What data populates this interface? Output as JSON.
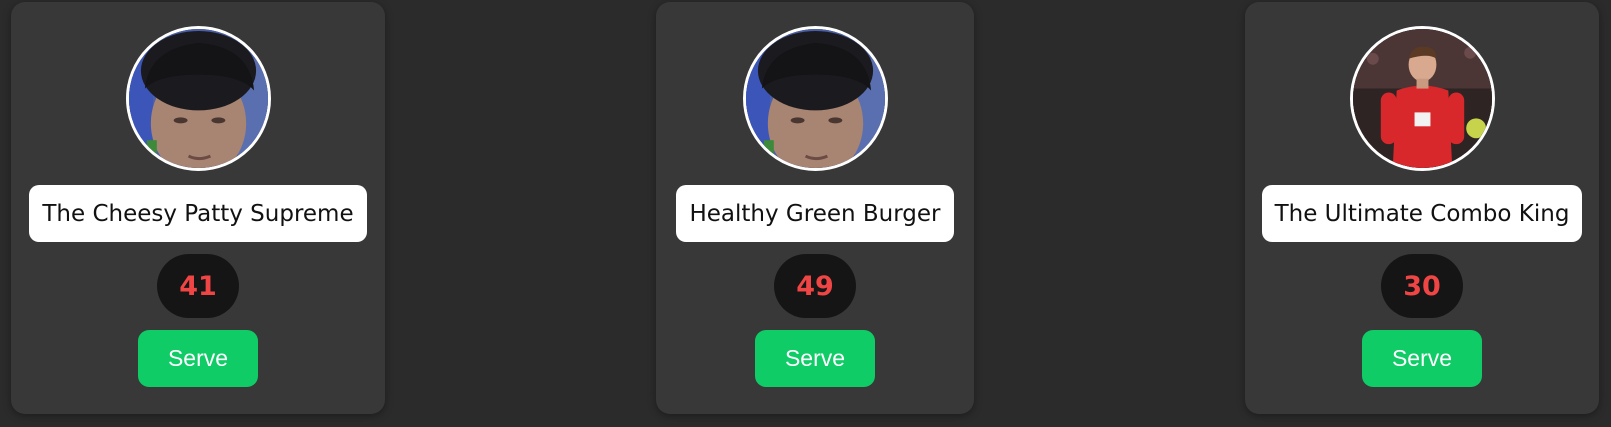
{
  "orders": [
    {
      "name": "The Cheesy Patty Supreme",
      "count": "41",
      "button_label": "Serve",
      "avatar": "boy-portrait-photo"
    },
    {
      "name": "Healthy Green Burger",
      "count": "49",
      "button_label": "Serve",
      "avatar": "boy-portrait-photo"
    },
    {
      "name": "The Ultimate Combo King",
      "count": "30",
      "button_label": "Serve",
      "avatar": "footballer-red-jersey-photo"
    }
  ],
  "colors": {
    "page_background": "#2b2b2b",
    "card_background": "#383838",
    "count_text": "#f04545",
    "count_pill": "#151515",
    "serve_button": "#0fcc66"
  }
}
